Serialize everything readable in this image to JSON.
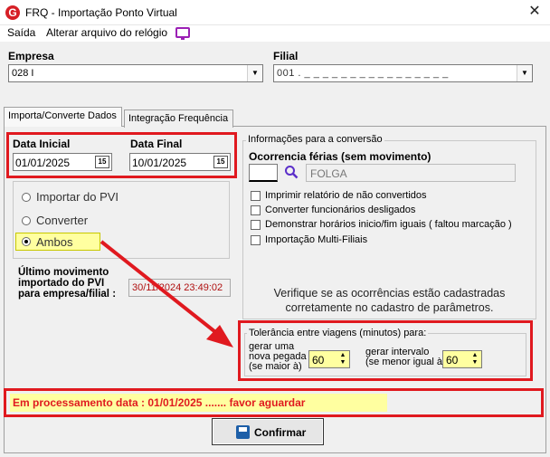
{
  "window": {
    "title": "FRQ - Importação Ponto Virtual",
    "icon_letter": "G",
    "close_glyph": "✕"
  },
  "menu": {
    "items": [
      "Saída",
      "Alterar arquivo do relógio"
    ]
  },
  "empresa": {
    "label": "Empresa",
    "value": "028 I"
  },
  "filial": {
    "label": "Filial",
    "value": "001 . _ _ _ _ _ _ _ _ _ _ _ _ _ _ _ _"
  },
  "tabs": [
    {
      "label": "Importa/Converte Dados",
      "active": true
    },
    {
      "label": "Integração Frequência",
      "active": false
    }
  ],
  "dates": {
    "inicial_label": "Data Inicial",
    "inicial_value": "01/01/2025",
    "final_label": "Data Final",
    "final_value": "10/01/2025",
    "cal_glyph": "15"
  },
  "modes": {
    "options": [
      "Importar do PVI",
      "Converter",
      "Ambos"
    ],
    "selected": "Ambos"
  },
  "last_movement": {
    "label_lines": [
      "Último movimento",
      "importado do PVI",
      "para empresa/filial :"
    ],
    "value": "30/11/2024  23:49:02"
  },
  "conversion": {
    "legend": "Informações para a conversão",
    "ocorrencia_label": "Ocorrencia férias (sem movimento)",
    "ocorrencia_code": "",
    "ocorrencia_desc": "FOLGA",
    "checkboxes": [
      "Imprimir relatório de não convertidos",
      "Converter funcionários desligados",
      "Demonstrar horários inicio/fim iguais ( faltou marcação )",
      "Importação Multi-Filiais"
    ],
    "notice_lines": [
      "Verifique se as ocorrências estão cadastradas",
      "corretamente  no cadastro de parâmetros."
    ]
  },
  "tolerance": {
    "legend": "Tolerância entre viagens (minutos) para:",
    "nova_lines": [
      "gerar uma",
      "nova pegada",
      "(se maior à)"
    ],
    "nova_value": "60",
    "intervalo_lines": [
      "gerar intervalo",
      "(se menor igual à)"
    ],
    "intervalo_value": "60"
  },
  "status": {
    "text": "Em processamento  data : 01/01/2025 ....... favor aguardar"
  },
  "confirm": {
    "label": "Confirmar"
  },
  "colors": {
    "highlight_red": "#e0191f",
    "status_text": "#e0191f",
    "status_bg": "#ffffa0",
    "spinner_bg": "#ffffa0",
    "menu_icon": "#9b20b5"
  }
}
